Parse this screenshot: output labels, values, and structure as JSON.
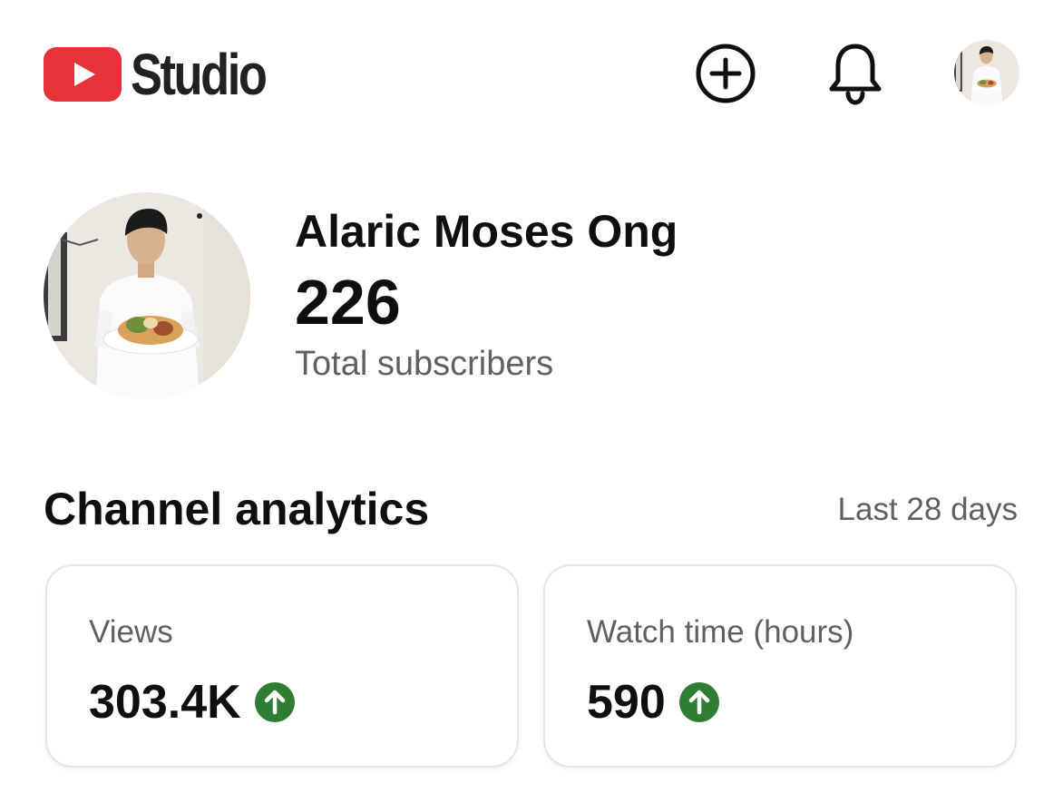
{
  "header": {
    "brand_name": "Studio",
    "icons": {
      "logo": "youtube-play-icon",
      "create": "add-circle-icon",
      "notifications": "bell-icon",
      "account": "avatar"
    },
    "colors": {
      "logo_red": "#e8323a"
    }
  },
  "channel": {
    "name": "Alaric Moses Ong",
    "subscriber_count": "226",
    "subscriber_label": "Total subscribers"
  },
  "analytics": {
    "title": "Channel analytics",
    "period": "Last 28 days",
    "cards": [
      {
        "label": "Views",
        "value": "303.4K",
        "trend": "up",
        "trend_icon": "arrow-up-icon"
      },
      {
        "label": "Watch time (hours)",
        "value": "590",
        "trend": "up",
        "trend_icon": "arrow-up-icon"
      }
    ],
    "colors": {
      "trend_up": "#2e7d32"
    }
  }
}
